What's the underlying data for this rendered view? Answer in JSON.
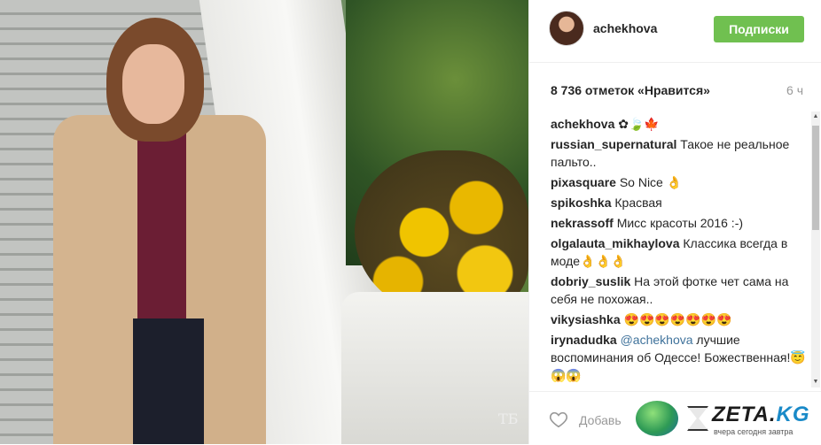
{
  "post": {
    "username": "achekhova",
    "follow_label": "Подписки",
    "likes": "8 736 отметок «Нравится»",
    "time": "6 ч",
    "add_comment_placeholder": "Добавь"
  },
  "comments": [
    {
      "author": "achekhova",
      "text": " ✿🍃🍁"
    },
    {
      "author": "russian_supernatural",
      "text": " Такое не реальное пальто.."
    },
    {
      "author": "pixasquare",
      "text": " So Nice 👌"
    },
    {
      "author": "spikoshka",
      "text": " Красвая"
    },
    {
      "author": "nekrassoff",
      "text": " Мисс красоты 2016 :-)"
    },
    {
      "author": "olgalauta_mikhaylova",
      "text": " Классика всегда в моде👌👌👌"
    },
    {
      "author": "dobriy_suslik",
      "text": " На этой фотке чет сама на себя не похожая.."
    },
    {
      "author": "vikysiashka",
      "text": " 😍😍😍😍😍😍😍"
    },
    {
      "author": "irynadudka",
      "mention": "@achekhova",
      "text": " лучшие воспоминания об Одессе! Божественная!😇😱😱"
    }
  ],
  "watermark": {
    "photo_mark": "ТБ",
    "brand_main": "ZETA.",
    "brand_tld": "KG",
    "slogan": "вчера сегодня завтра"
  },
  "icons": {
    "heart": "heart-icon",
    "scroll_up": "scroll-up-arrow",
    "scroll_down": "scroll-down-arrow"
  },
  "colors": {
    "follow_button": "#70c050",
    "mention": "#3f729b"
  }
}
